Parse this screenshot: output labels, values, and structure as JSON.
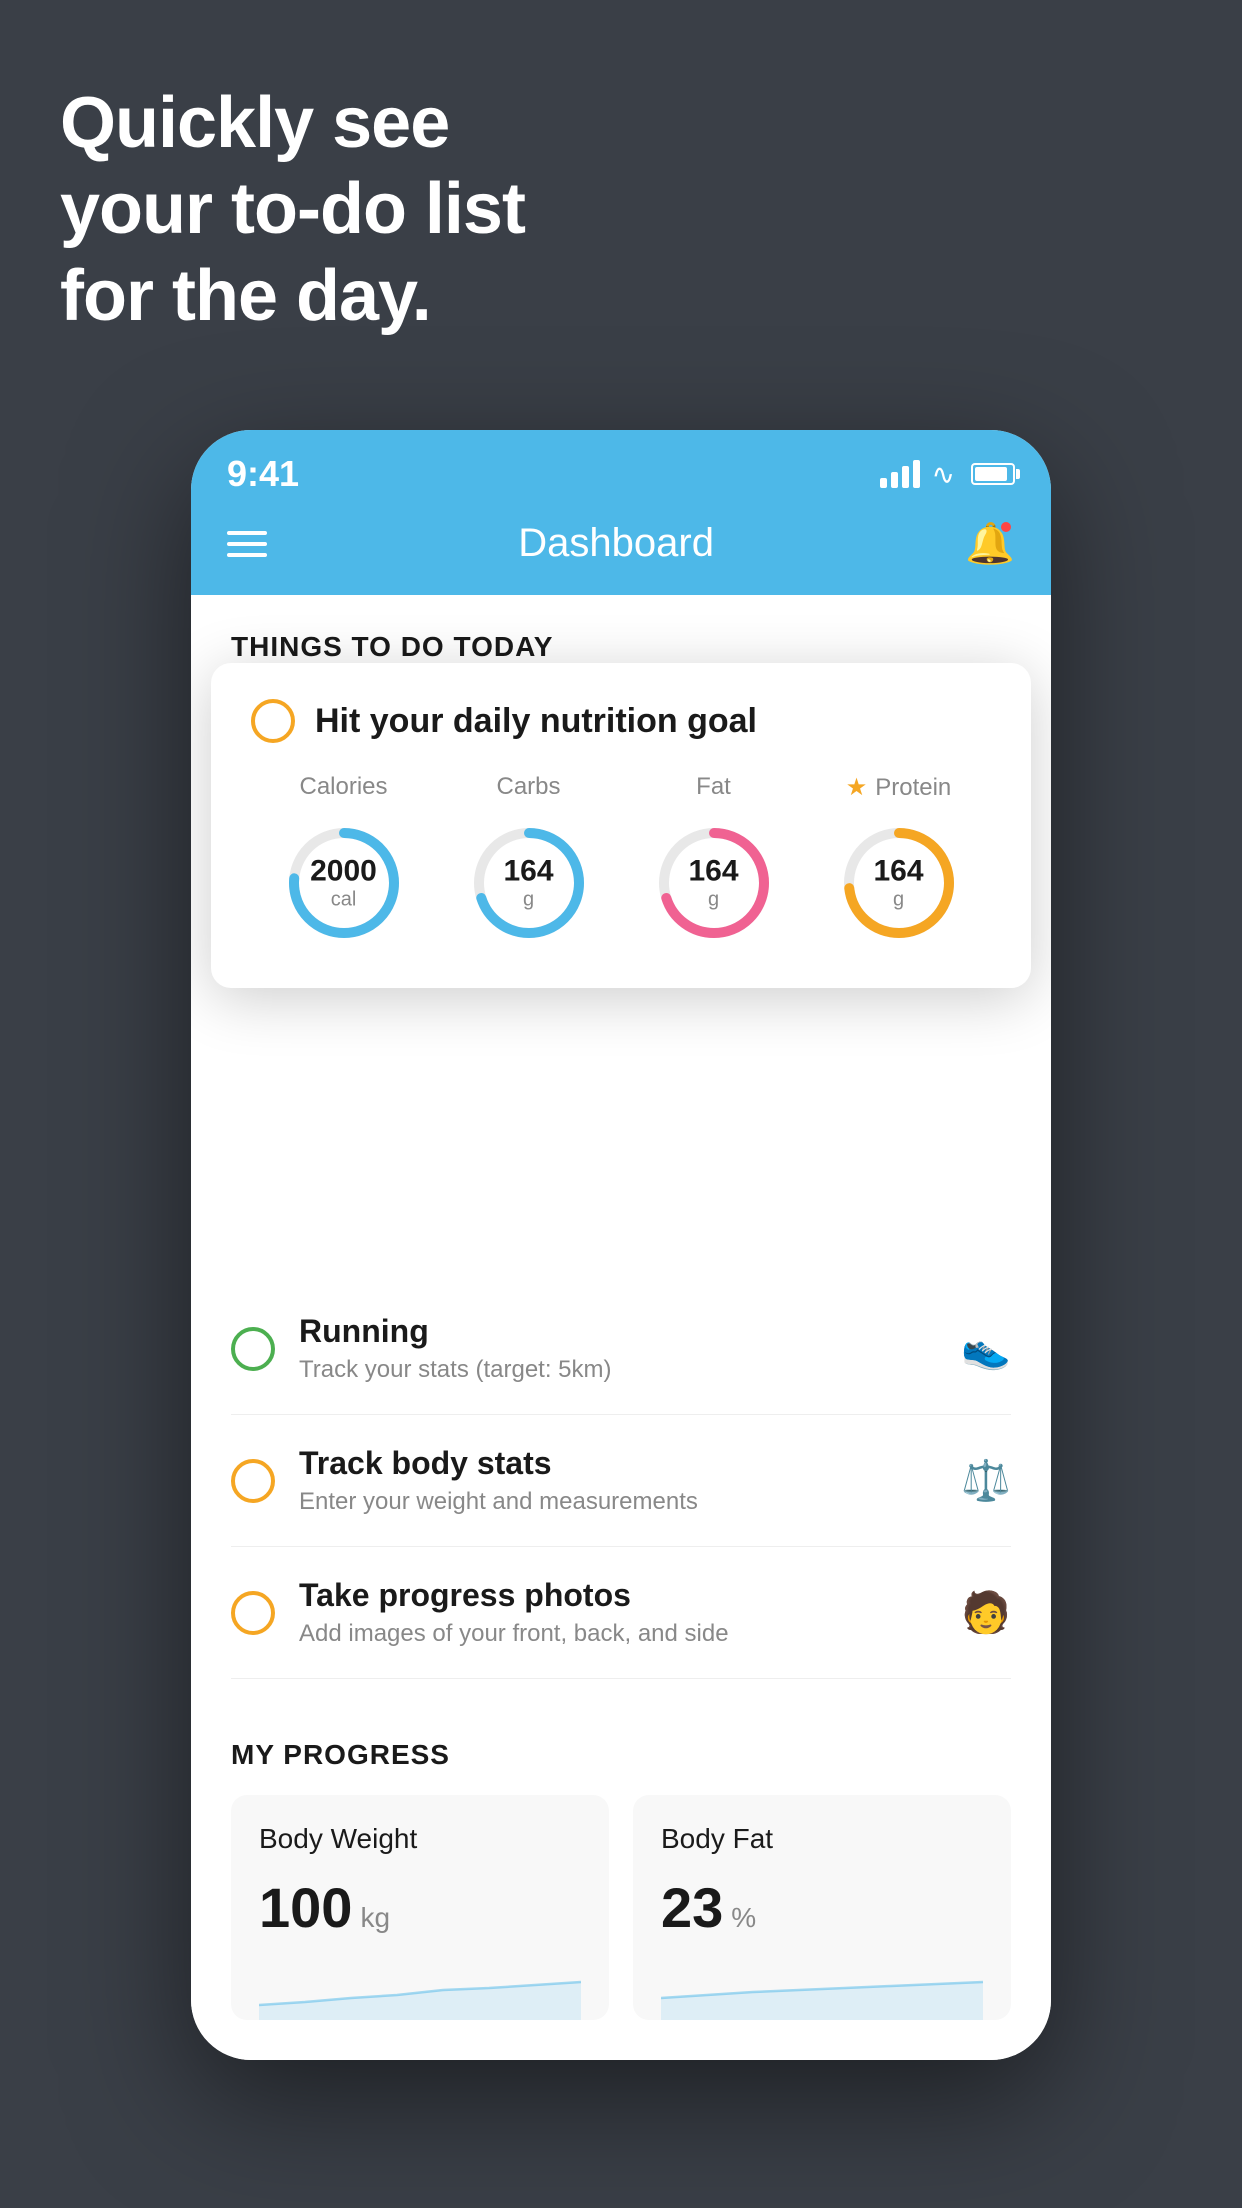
{
  "hero": {
    "line1": "Quickly see",
    "line2": "your to-do list",
    "line3": "for the day."
  },
  "phone": {
    "status": {
      "time": "9:41"
    },
    "nav": {
      "title": "Dashboard"
    },
    "things_header": "THINGS TO DO TODAY",
    "floating_card": {
      "title": "Hit your daily nutrition goal",
      "labels": [
        "Calories",
        "Carbs",
        "Fat",
        "Protein"
      ],
      "circles": [
        {
          "value": "2000",
          "unit": "cal",
          "color": "blue"
        },
        {
          "value": "164",
          "unit": "g",
          "color": "blue"
        },
        {
          "value": "164",
          "unit": "g",
          "color": "pink"
        },
        {
          "value": "164",
          "unit": "g",
          "color": "yellow"
        }
      ]
    },
    "tasks": [
      {
        "name": "Running",
        "desc": "Track your stats (target: 5km)",
        "icon": "👟",
        "checked": true,
        "circle_color": "green"
      },
      {
        "name": "Track body stats",
        "desc": "Enter your weight and measurements",
        "icon": "⚖️",
        "checked": false,
        "circle_color": "yellow"
      },
      {
        "name": "Take progress photos",
        "desc": "Add images of your front, back, and side",
        "icon": "🧑",
        "checked": false,
        "circle_color": "yellow"
      }
    ],
    "progress": {
      "header": "MY PROGRESS",
      "cards": [
        {
          "title": "Body Weight",
          "value": "100",
          "unit": "kg"
        },
        {
          "title": "Body Fat",
          "value": "23",
          "unit": "%"
        }
      ]
    }
  }
}
